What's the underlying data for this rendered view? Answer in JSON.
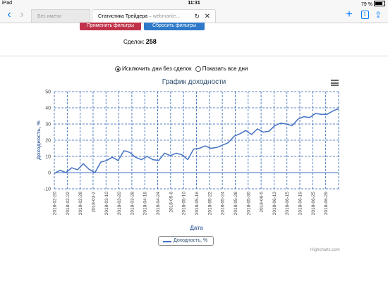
{
  "statusbar": {
    "device": "iPad",
    "time": "11:31",
    "battery": "79 %"
  },
  "browser": {
    "tab_inactive": "Без имени",
    "tab_active_title": "Статистика Трейдера",
    "tab_active_sub": " – webmarke...",
    "reload_icon": "↻",
    "close_icon": "✕"
  },
  "filters": {
    "apply_label": "Применить фильтры",
    "reset_label": "Сбросить фильтры"
  },
  "deals": {
    "label": "Сделок:",
    "count": "258"
  },
  "options": {
    "exclude_label": "Исключить дни без сделок",
    "show_all_label": "Показать все дни",
    "selected": "exclude"
  },
  "chart_data": {
    "type": "line",
    "title": "График доходности",
    "xlabel": "Дата",
    "ylabel": "Доходность, %",
    "ylim": [
      -10,
      50
    ],
    "yticks": [
      -10,
      0,
      10,
      20,
      30,
      40,
      50
    ],
    "x_tick_labels": [
      "2018-02-20",
      "2018-02-22",
      "2018-02-28",
      "2018-03-2",
      "2018-03-10",
      "2018-03-20",
      "2018-03-28",
      "2018-04-16",
      "2018-04-24",
      "2018-05-6",
      "2018-05-10",
      "2018-05-16",
      "2018-05-22",
      "2018-05-24",
      "2018-05-28",
      "2018-05-30",
      "2018-06-5",
      "2018-06-13",
      "2018-06-15",
      "2018-06-19",
      "2018-06-25",
      "2018-06-29"
    ],
    "grid": true,
    "legend_position": "bottom-center",
    "series": [
      {
        "name": "Доходность, %",
        "color": "#4572c4",
        "values": [
          -0.5,
          1.5,
          0,
          3,
          1.8,
          5.5,
          2,
          0,
          6.5,
          7.5,
          9.5,
          7.5,
          13.5,
          12.5,
          9.5,
          8,
          10,
          8,
          7.5,
          12,
          10.5,
          12,
          11,
          8,
          14.5,
          15,
          16.5,
          15,
          15.5,
          17,
          18.5,
          22.5,
          24,
          26,
          23.5,
          27,
          25,
          25.5,
          29,
          30.5,
          30,
          29,
          33,
          34.5,
          34,
          36.5,
          36,
          36,
          38,
          39.5
        ]
      }
    ]
  },
  "credits": "Highcharts.com"
}
